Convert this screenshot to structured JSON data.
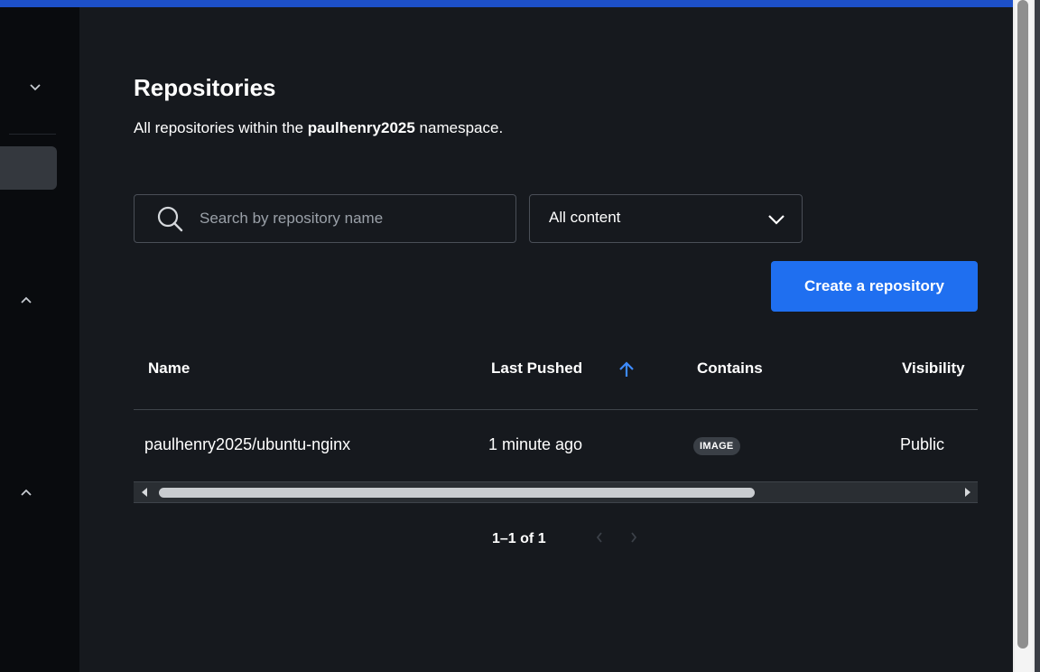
{
  "page": {
    "title": "Repositories",
    "description_prefix": "All repositories within the ",
    "namespace": "paulhenry2025",
    "description_suffix": " namespace."
  },
  "search": {
    "placeholder": "Search by repository name",
    "value": ""
  },
  "filter": {
    "selected": "All content",
    "options": [
      "All content"
    ]
  },
  "actions": {
    "create_label": "Create a repository"
  },
  "table": {
    "columns": [
      "Name",
      "Last Pushed",
      "Contains",
      "Visibility"
    ],
    "sort_icon": "arrow-up-icon",
    "rows": [
      {
        "name": "paulhenry2025/ubuntu-nginx",
        "last_pushed": "1 minute ago",
        "contains": "IMAGE",
        "visibility": "Public"
      }
    ]
  },
  "pagination": {
    "range": "1–1 of 1"
  },
  "colors": {
    "accent_blue": "#1f6ff0",
    "top_bar": "#1d50c8",
    "background": "#16191e",
    "sidebar": "#090b0e"
  }
}
